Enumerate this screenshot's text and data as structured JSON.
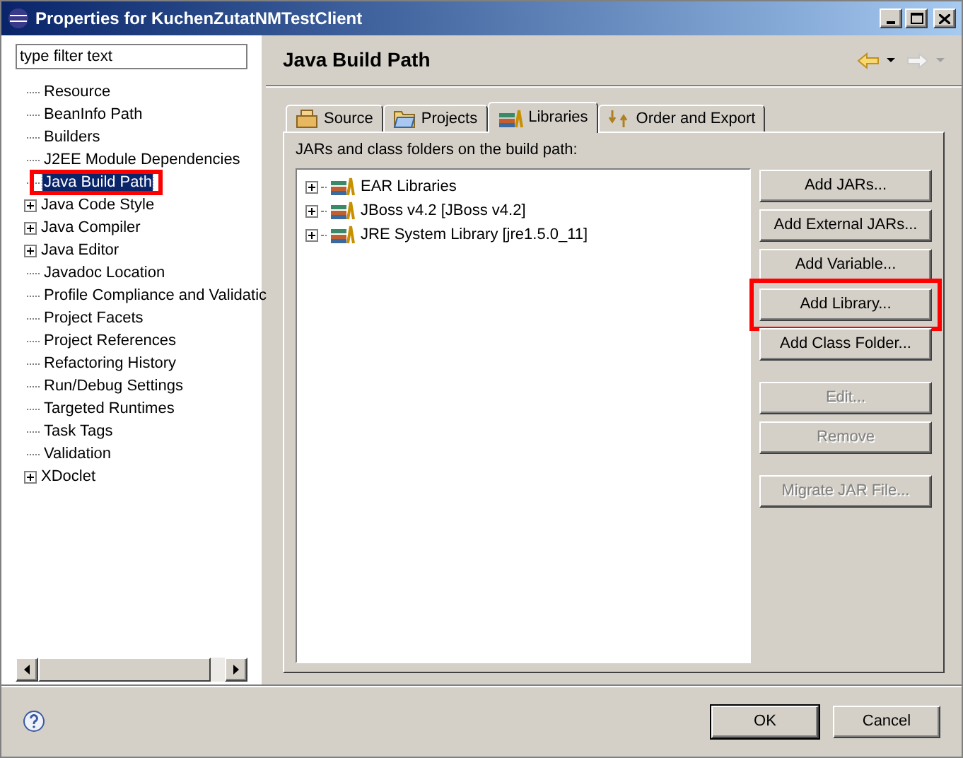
{
  "window": {
    "title": "Properties for KuchenZutatNMTestClient"
  },
  "filter": {
    "placeholder": "type filter text"
  },
  "tree": [
    {
      "label": "Resource",
      "expandable": false,
      "selected": false,
      "highlighted": false
    },
    {
      "label": "BeanInfo Path",
      "expandable": false,
      "selected": false,
      "highlighted": false
    },
    {
      "label": "Builders",
      "expandable": false,
      "selected": false,
      "highlighted": false
    },
    {
      "label": "J2EE Module Dependencies",
      "expandable": false,
      "selected": false,
      "highlighted": false
    },
    {
      "label": "Java Build Path",
      "expandable": false,
      "selected": true,
      "highlighted": true
    },
    {
      "label": "Java Code Style",
      "expandable": true,
      "selected": false,
      "highlighted": false
    },
    {
      "label": "Java Compiler",
      "expandable": true,
      "selected": false,
      "highlighted": false
    },
    {
      "label": "Java Editor",
      "expandable": true,
      "selected": false,
      "highlighted": false
    },
    {
      "label": "Javadoc Location",
      "expandable": false,
      "selected": false,
      "highlighted": false
    },
    {
      "label": "Profile Compliance and Validatic",
      "expandable": false,
      "selected": false,
      "highlighted": false
    },
    {
      "label": "Project Facets",
      "expandable": false,
      "selected": false,
      "highlighted": false
    },
    {
      "label": "Project References",
      "expandable": false,
      "selected": false,
      "highlighted": false
    },
    {
      "label": "Refactoring History",
      "expandable": false,
      "selected": false,
      "highlighted": false
    },
    {
      "label": "Run/Debug Settings",
      "expandable": false,
      "selected": false,
      "highlighted": false
    },
    {
      "label": "Targeted Runtimes",
      "expandable": false,
      "selected": false,
      "highlighted": false
    },
    {
      "label": "Task Tags",
      "expandable": false,
      "selected": false,
      "highlighted": false
    },
    {
      "label": "Validation",
      "expandable": false,
      "selected": false,
      "highlighted": false
    },
    {
      "label": "XDoclet",
      "expandable": true,
      "selected": false,
      "highlighted": false
    }
  ],
  "page": {
    "title": "Java Build Path"
  },
  "tabs": [
    {
      "label": "Source",
      "selected": false
    },
    {
      "label": "Projects",
      "selected": false
    },
    {
      "label": "Libraries",
      "selected": true
    },
    {
      "label": "Order and Export",
      "selected": false
    }
  ],
  "list_label": "JARs and class folders on the build path:",
  "libraries": [
    "EAR Libraries",
    "JBoss v4.2 [JBoss v4.2]",
    "JRE System Library [jre1.5.0_11]"
  ],
  "button_groups": [
    [
      {
        "label": "Add JARs...",
        "disabled": false,
        "highlighted": false
      },
      {
        "label": "Add External JARs...",
        "disabled": false,
        "highlighted": false
      },
      {
        "label": "Add Variable...",
        "disabled": false,
        "highlighted": false
      },
      {
        "label": "Add Library...",
        "disabled": false,
        "highlighted": true
      },
      {
        "label": "Add Class Folder...",
        "disabled": false,
        "highlighted": false
      }
    ],
    [
      {
        "label": "Edit...",
        "disabled": true,
        "highlighted": false
      },
      {
        "label": "Remove",
        "disabled": true,
        "highlighted": false
      }
    ],
    [
      {
        "label": "Migrate JAR File...",
        "disabled": true,
        "highlighted": false
      }
    ]
  ],
  "footer": {
    "ok": "OK",
    "cancel": "Cancel"
  }
}
